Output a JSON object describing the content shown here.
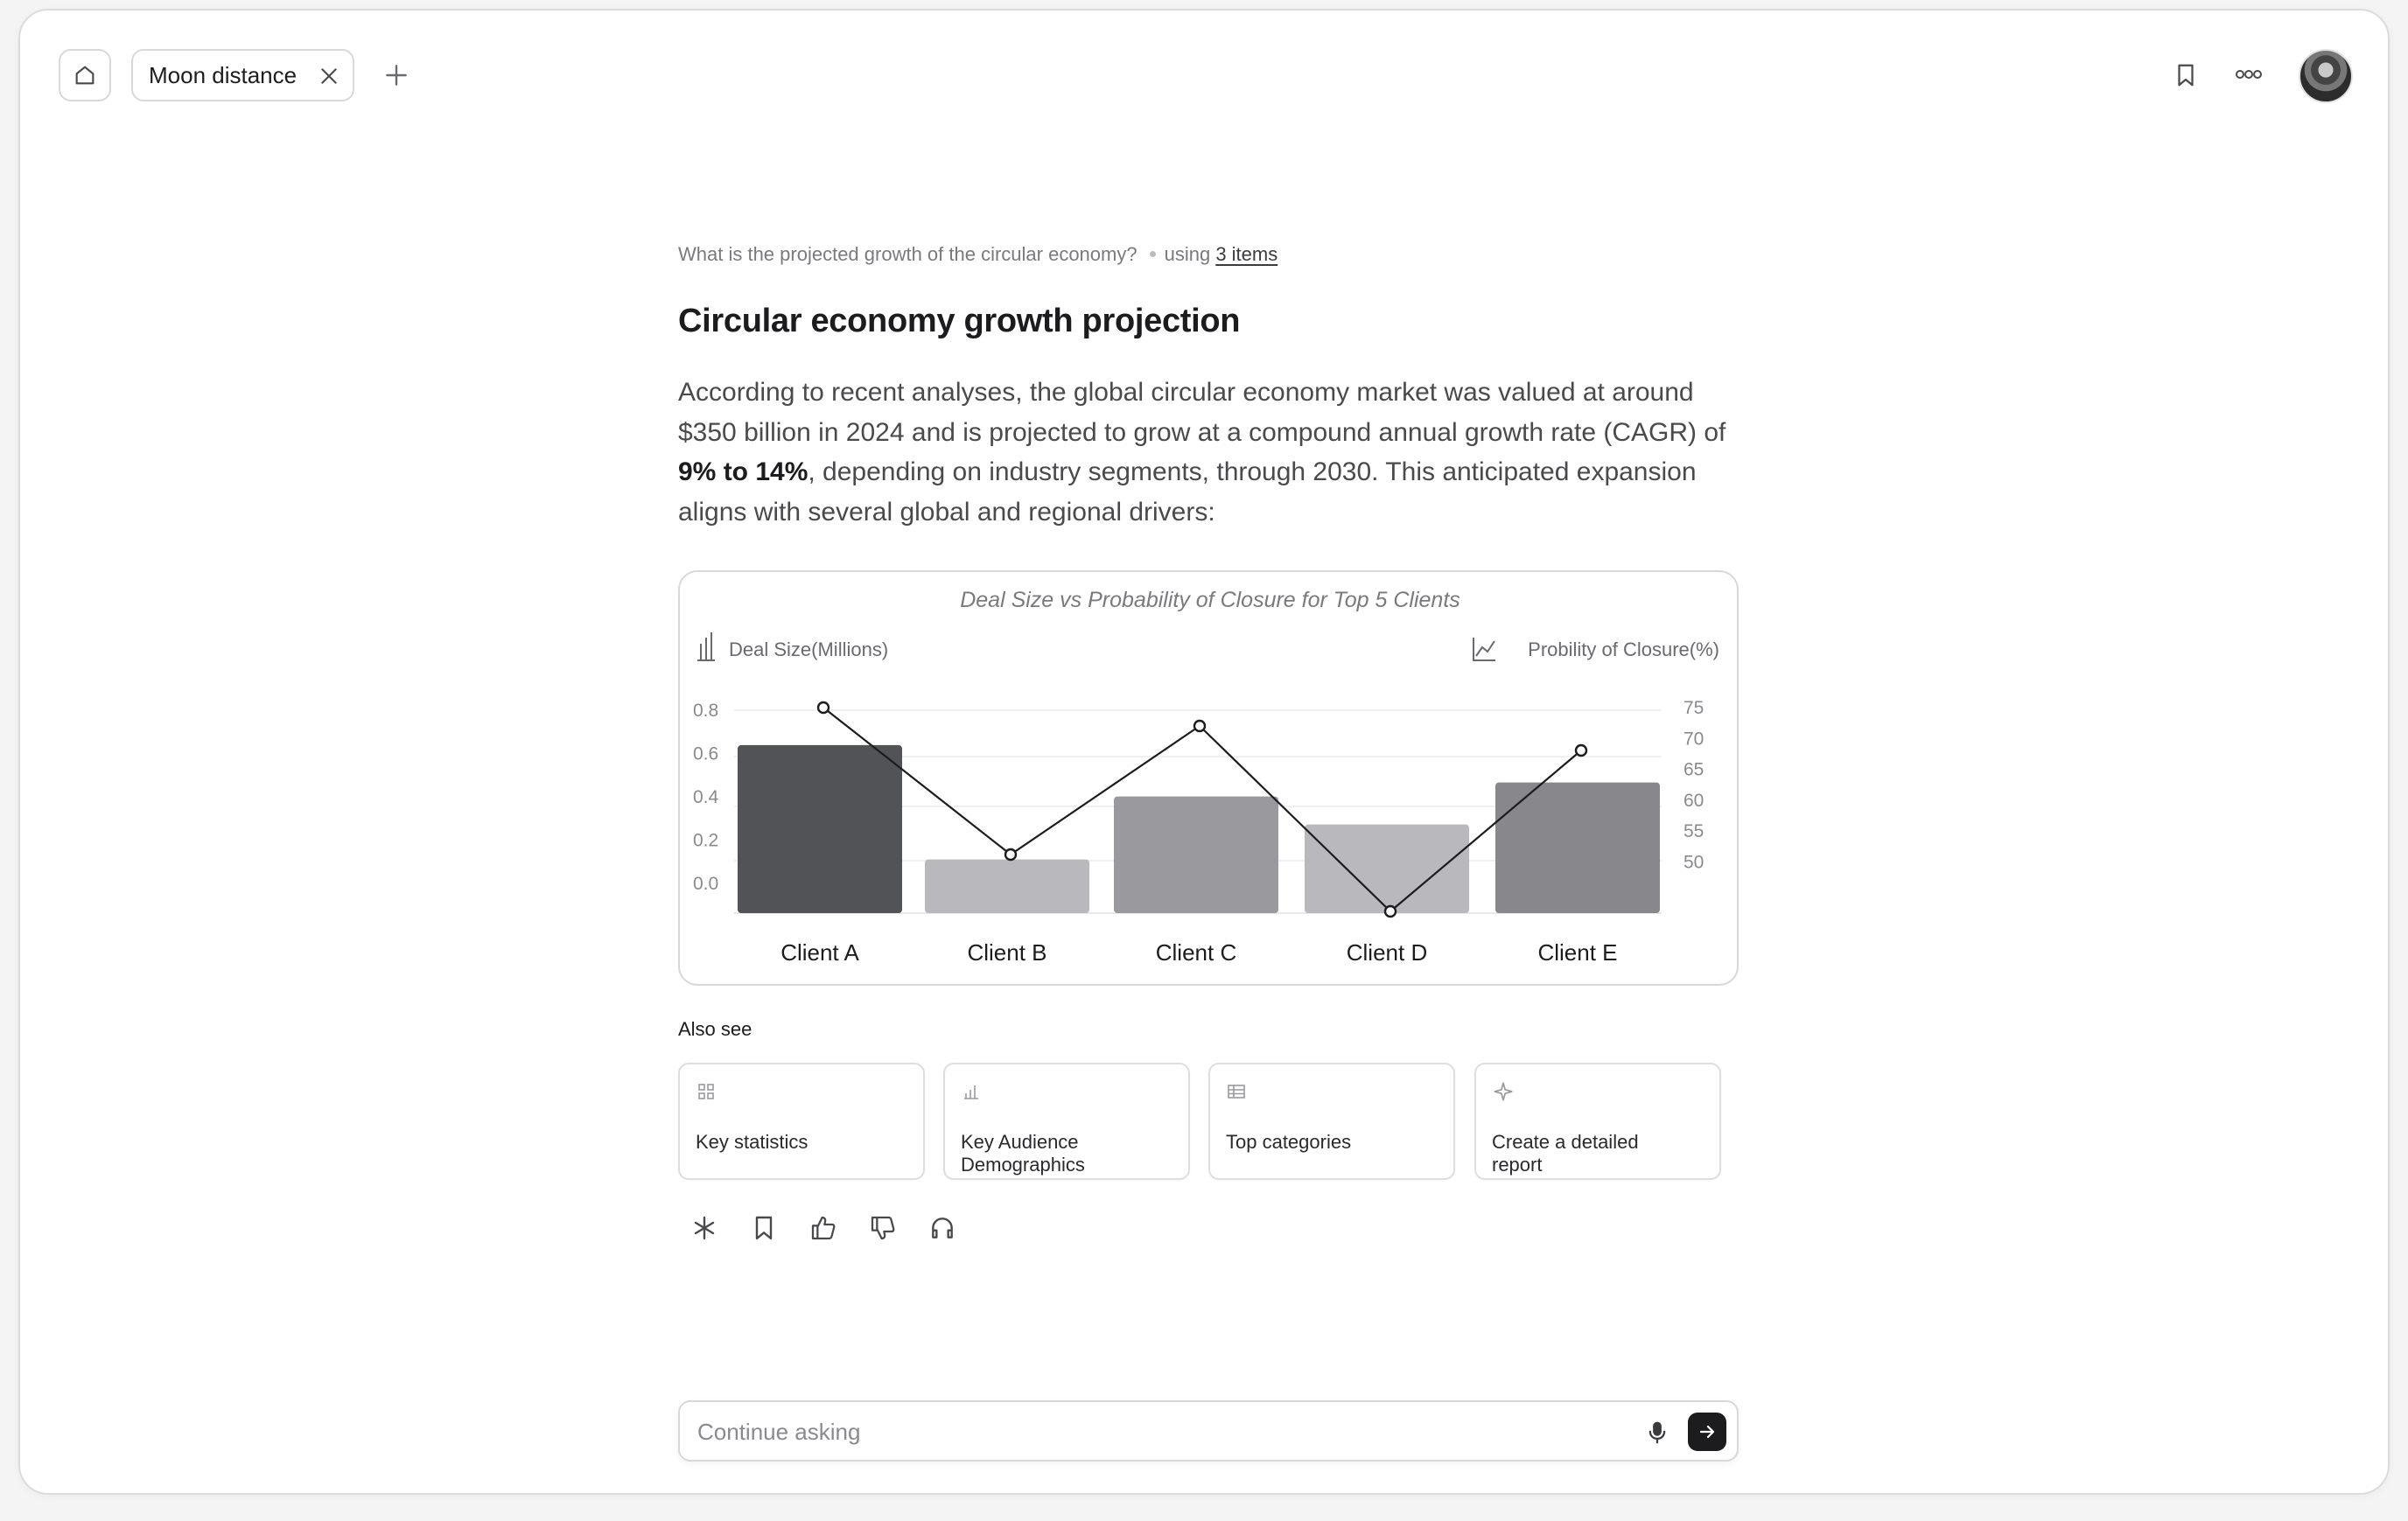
{
  "tab": {
    "label": "Moon distance"
  },
  "query": {
    "question": "What is the projected growth of the circular economy?",
    "using_prefix": "using",
    "sources_link": "3 items"
  },
  "answer": {
    "title": "Circular economy growth projection",
    "para_part1": "According to recent analyses, the global circular economy market was valued at around $350 billion in 2024 and is projected to grow at a compound annual growth rate (CAGR) of ",
    "para_bold": "9% to 14%",
    "para_part2": ", depending on industry segments, through 2030. This anticipated expansion aligns with several global and regional drivers:"
  },
  "chart_data": {
    "type": "bar+line",
    "title": "Deal Size vs Probability of Closure for Top 5 Clients",
    "categories": [
      "Client A",
      "Client B",
      "Client C",
      "Client D",
      "Client E"
    ],
    "series": [
      {
        "name": "Deal Size(Millions)",
        "type": "bar",
        "axis": "left",
        "values": [
          0.72,
          0.23,
          0.5,
          0.38,
          0.56
        ],
        "colors": [
          "#515357",
          "#b9b9bd",
          "#9a9a9e",
          "#b9b9bd",
          "#88888c"
        ]
      },
      {
        "name": "Probility of Closure(%)",
        "type": "line",
        "axis": "right",
        "values": [
          75,
          51,
          72,
          41,
          68
        ]
      }
    ],
    "left_axis": {
      "label": "Deal Size(Millions)",
      "ticks": [
        "0.8",
        "0.6",
        "0.4",
        "0.2",
        "0.0"
      ],
      "ylim": [
        0,
        0.8
      ]
    },
    "right_axis": {
      "label": "Probility of Closure(%)",
      "ticks": [
        "75",
        "70",
        "65",
        "60",
        "55",
        "50"
      ],
      "ylim": [
        50,
        75
      ]
    },
    "grid": true,
    "legend": "top"
  },
  "also_see": {
    "heading": "Also see",
    "cards": [
      {
        "icon": "grid-icon",
        "label": "Key statistics"
      },
      {
        "icon": "bar-chart-icon",
        "label": "Key Audience Demographics"
      },
      {
        "icon": "table-icon",
        "label": "Top categories"
      },
      {
        "icon": "sparkle-icon",
        "label": "Create a detailed report"
      }
    ]
  },
  "actions": [
    "asterisk-icon",
    "bookmark-icon",
    "thumbs-up-icon",
    "thumbs-down-icon",
    "headphones-icon"
  ],
  "input": {
    "placeholder": "Continue asking",
    "value": ""
  }
}
